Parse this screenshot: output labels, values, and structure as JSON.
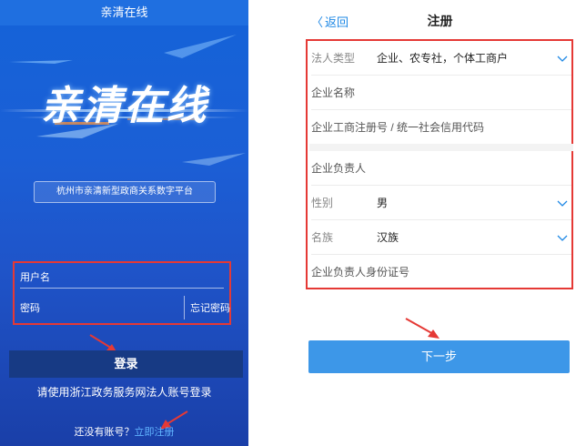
{
  "login": {
    "status_title": "亲清在线",
    "logo_text": "亲清在线",
    "platform_name": "杭州市亲清新型政商关系数字平台",
    "username_placeholder": "用户名",
    "password_placeholder": "密码",
    "forgot_password": "忘记密码",
    "login_button": "登录",
    "hint": "请使用浙江政务服务网法人账号登录",
    "no_account_text": "还没有账号？",
    "register_link": "立即注册"
  },
  "register": {
    "back_label": "返回",
    "title": "注册",
    "fields": {
      "legal_type_label": "法人类型",
      "legal_type_value": "企业、农专社，个体工商户",
      "company_name_label": "企业名称",
      "registration_no_label": "企业工商注册号 / 统一社会信用代码",
      "responsible_person_label": "企业负责人",
      "gender_label": "性别",
      "gender_value": "男",
      "ethnicity_label": "名族",
      "ethnicity_value": "汉族",
      "id_number_label": "企业负责人身份证号"
    },
    "next_button": "下一步"
  },
  "colors": {
    "highlight_border": "#e53935",
    "accent_blue": "#3d97e8",
    "login_bg": "#1b5fd6",
    "login_button_bg": "#173a84",
    "link_blue": "#61b4ff"
  },
  "icons": [
    "chevron-left-icon",
    "chevron-down-icon",
    "annotation-arrow-icon"
  ]
}
